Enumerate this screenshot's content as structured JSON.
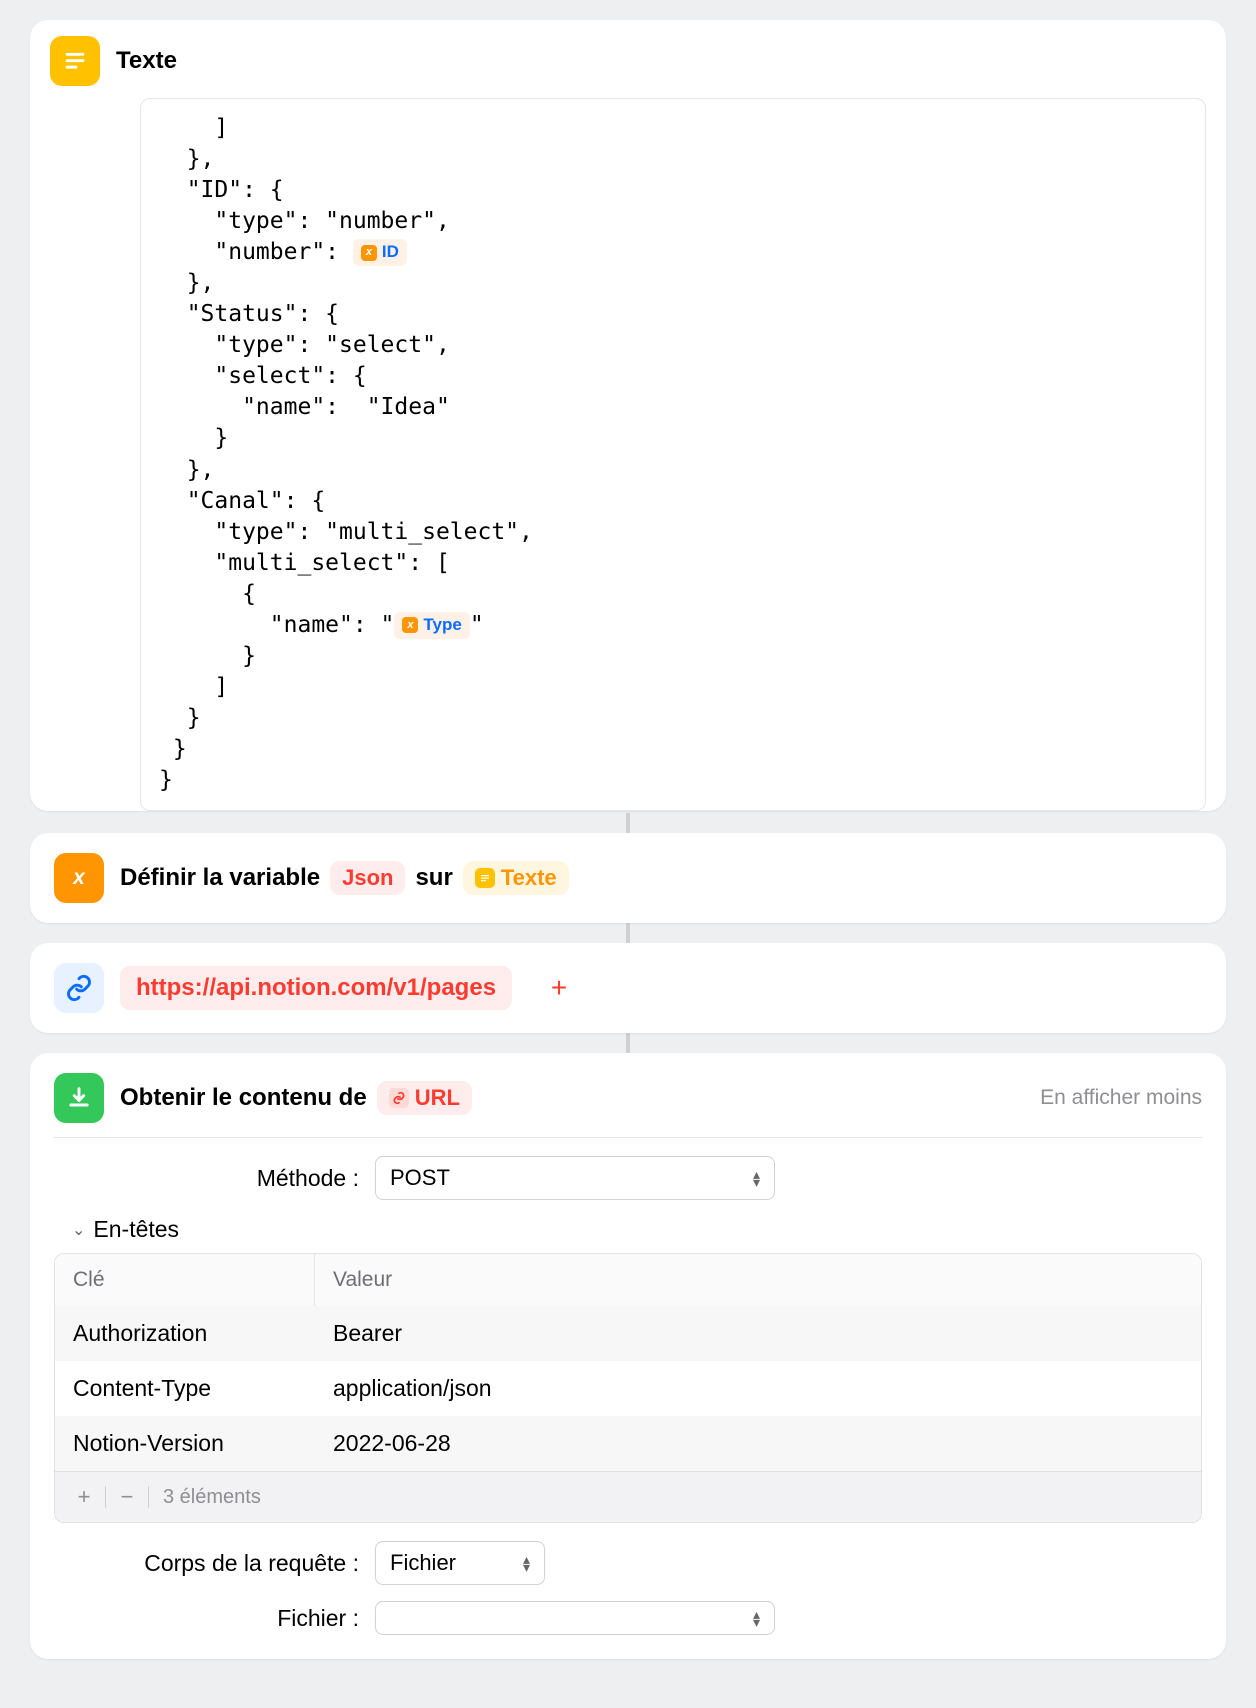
{
  "texte_block": {
    "title": "Texte",
    "code_lines": [
      "    ]",
      "  },",
      "  \"ID\": {",
      "    \"type\": \"number\",",
      "    \"number\": "
    ],
    "token_id": "ID",
    "code_lines_2": [
      "  },",
      "  \"Status\": {",
      "    \"type\": \"select\",",
      "    \"select\": {",
      "      \"name\":  \"Idea\"",
      "    }",
      "  },",
      "  \"Canal\": {",
      "    \"type\": \"multi_select\",",
      "    \"multi_select\": [",
      "      {",
      "        \"name\": \""
    ],
    "token_type": "Type",
    "code_lines_3": [
      "\"",
      "      }",
      "    ]",
      "  }",
      " }",
      "}"
    ]
  },
  "set_var": {
    "prefix": "Définir la variable",
    "var_name": "Json",
    "middle": "sur",
    "value_label": "Texte"
  },
  "url_block": {
    "url": "https://api.notion.com/v1/pages"
  },
  "get_contents": {
    "title": "Obtenir le contenu de",
    "url_pill": "URL",
    "show_less": "En afficher moins",
    "method_label": "Méthode :",
    "method_value": "POST",
    "headers_label": "En-têtes",
    "table": {
      "columns": [
        "Clé",
        "Valeur"
      ],
      "rows": [
        [
          "Authorization",
          "Bearer"
        ],
        [
          "Content-Type",
          "application/json"
        ],
        [
          "Notion-Version",
          "2022-06-28"
        ]
      ],
      "count_label": "3 éléments"
    },
    "body_label": "Corps de la requête :",
    "body_value": "Fichier",
    "file_label": "Fichier :",
    "file_value": ""
  }
}
